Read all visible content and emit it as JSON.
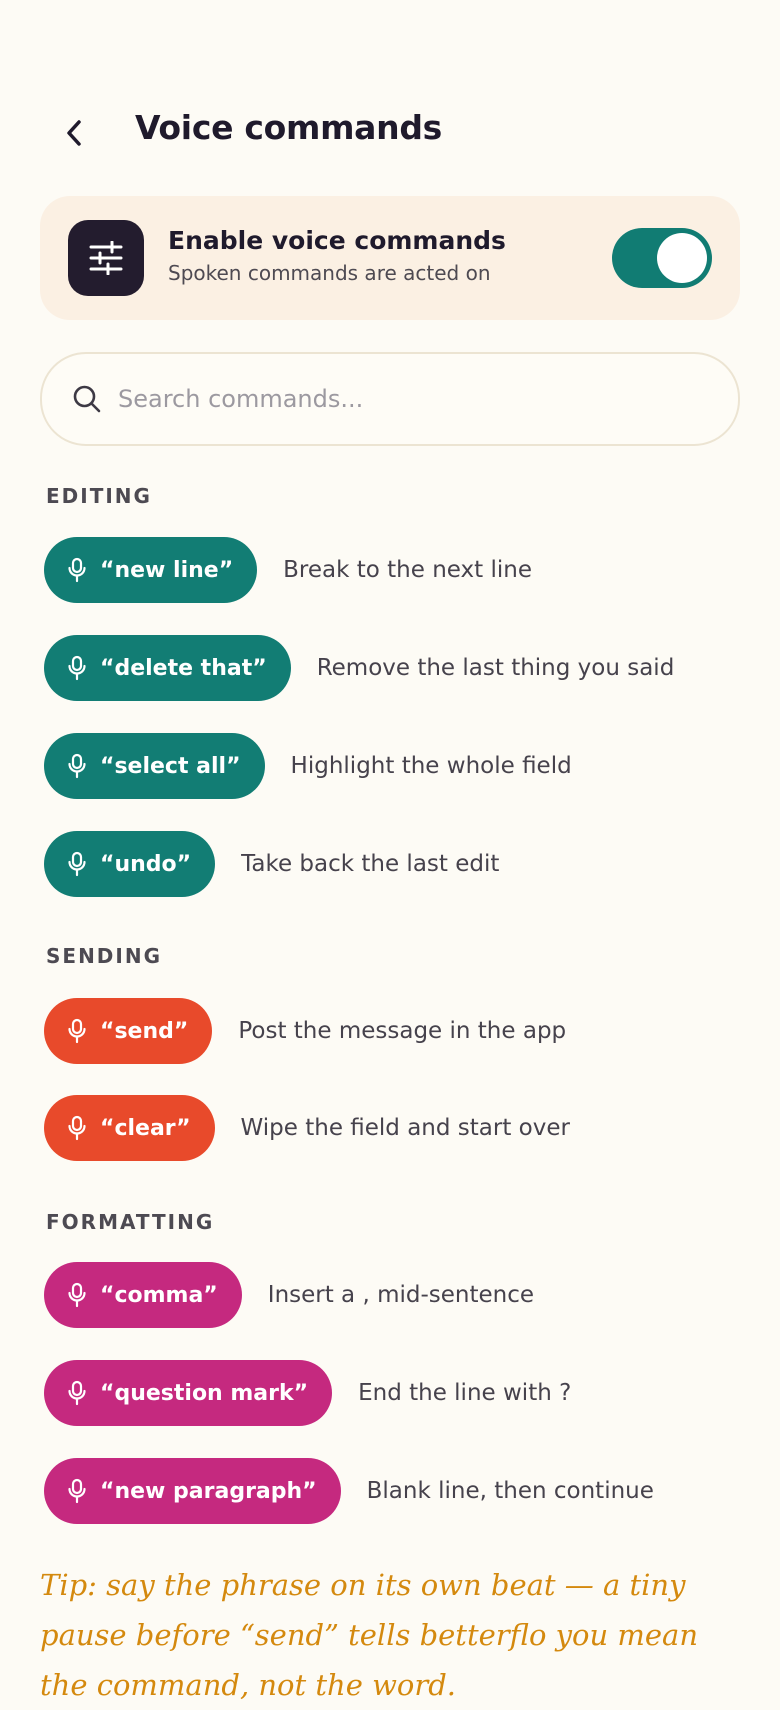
{
  "header": {
    "title": "Voice commands"
  },
  "enable": {
    "title": "Enable voice commands",
    "subtitle": "Spoken commands are acted on",
    "enabled": true
  },
  "search": {
    "placeholder": "Search commands..."
  },
  "sections": {
    "editing": {
      "label": "EDITING",
      "color": "#127d74",
      "items": [
        {
          "phrase": "“new line”",
          "desc": "Break to the next line"
        },
        {
          "phrase": "“delete that”",
          "desc": "Remove the last thing you said"
        },
        {
          "phrase": "“select all”",
          "desc": "Highlight the whole field"
        },
        {
          "phrase": "“undo”",
          "desc": "Take back the last edit"
        }
      ]
    },
    "sending": {
      "label": "SENDING",
      "color": "#e84a2b",
      "items": [
        {
          "phrase": "“send”",
          "desc": "Post the message in the app"
        },
        {
          "phrase": "“clear”",
          "desc": "Wipe the field and start over"
        }
      ]
    },
    "formatting": {
      "label": "FORMATTING",
      "color": "#c5297f",
      "items": [
        {
          "phrase": "“comma”",
          "desc": "Insert a , mid-sentence"
        },
        {
          "phrase": "“question mark”",
          "desc": "End the line with ?"
        },
        {
          "phrase": "“new paragraph”",
          "desc": "Blank line, then continue"
        }
      ]
    }
  },
  "tip": "Tip: say the phrase on its own beat — a tiny pause before “send” tells betterflo you mean the command, not the word."
}
